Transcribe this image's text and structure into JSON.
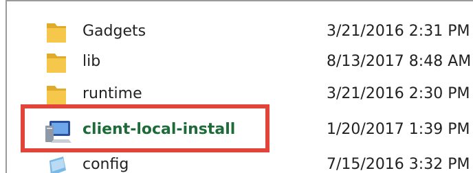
{
  "colors": {
    "folder": "#f5c84b",
    "folder_dark": "#e0aa2a",
    "highlight": "#e2443a",
    "selected_name": "#1e6b3a",
    "text": "#222222"
  },
  "files": [
    {
      "name": "Gadgets",
      "modified": "3/21/2016 2:31 PM",
      "icon": "folder-icon"
    },
    {
      "name": "lib",
      "modified": "8/13/2017 8:48 AM",
      "icon": "folder-icon"
    },
    {
      "name": "runtime",
      "modified": "3/21/2016 2:30 PM",
      "icon": "folder-icon"
    },
    {
      "name": "client-local-install",
      "modified": "1/20/2017 1:39 PM",
      "icon": "application-icon",
      "highlighted": true
    },
    {
      "name": "config",
      "modified": "7/15/2016 3:32 PM",
      "icon": "config-file-icon"
    }
  ]
}
